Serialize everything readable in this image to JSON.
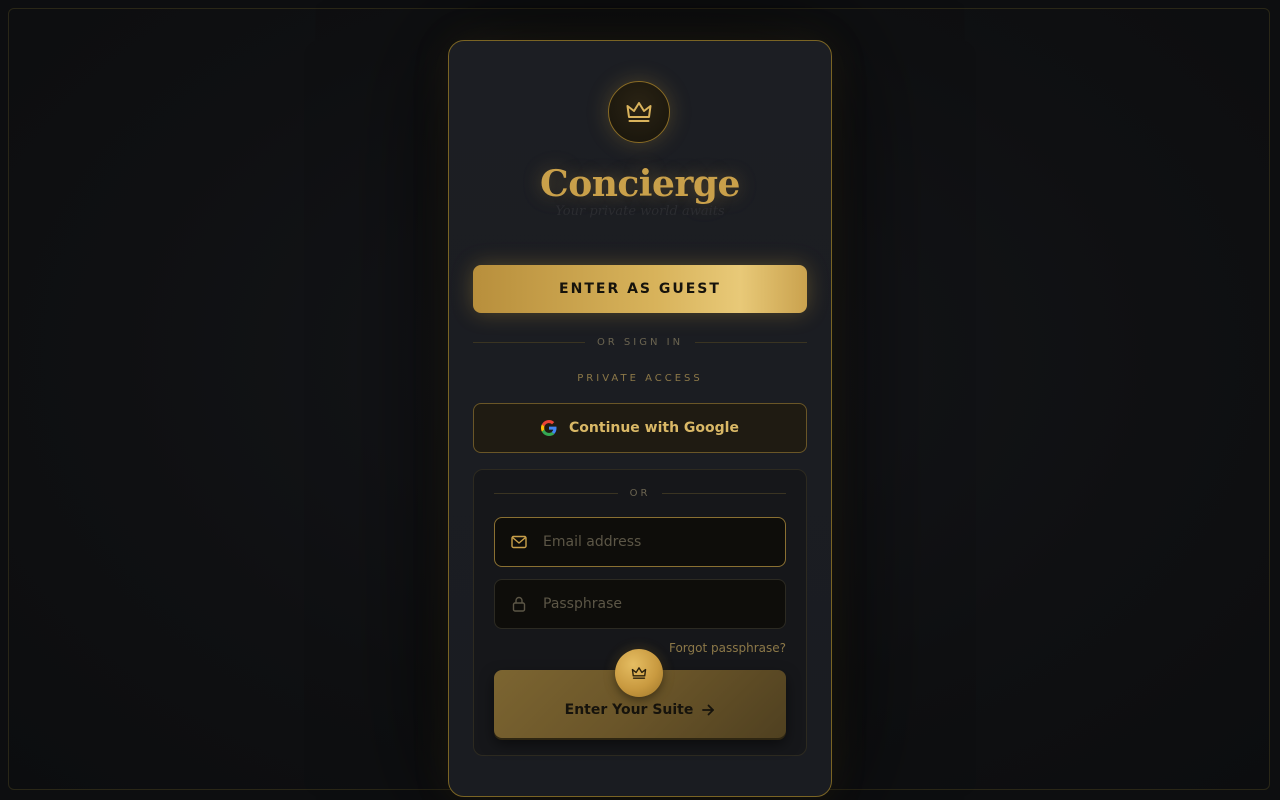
{
  "brand": {
    "name": "Concierge",
    "tagline": "Your private world awaits"
  },
  "guest": {
    "label": "ENTER AS GUEST"
  },
  "dividers": {
    "sign_in": "OR SIGN IN",
    "or": "OR"
  },
  "private_access": "PRIVATE ACCESS",
  "google": {
    "label": "Continue with Google"
  },
  "form": {
    "email_placeholder": "Email address",
    "email_value": "",
    "password_placeholder": "Passphrase",
    "password_value": "",
    "forgot_label": "Forgot passphrase?",
    "submit_label": "Enter Your Suite"
  },
  "icons": {
    "crest": "crown-icon",
    "google": "google-icon",
    "email": "mail-icon",
    "password": "lock-icon",
    "submit_badge": "crown-icon",
    "submit_arrow": "arrow-right-icon"
  },
  "colors": {
    "gold": "#c9a04a",
    "gold_light": "#e8c978",
    "card_bg": "#1c1e23",
    "page_bg": "#0d0e10"
  }
}
